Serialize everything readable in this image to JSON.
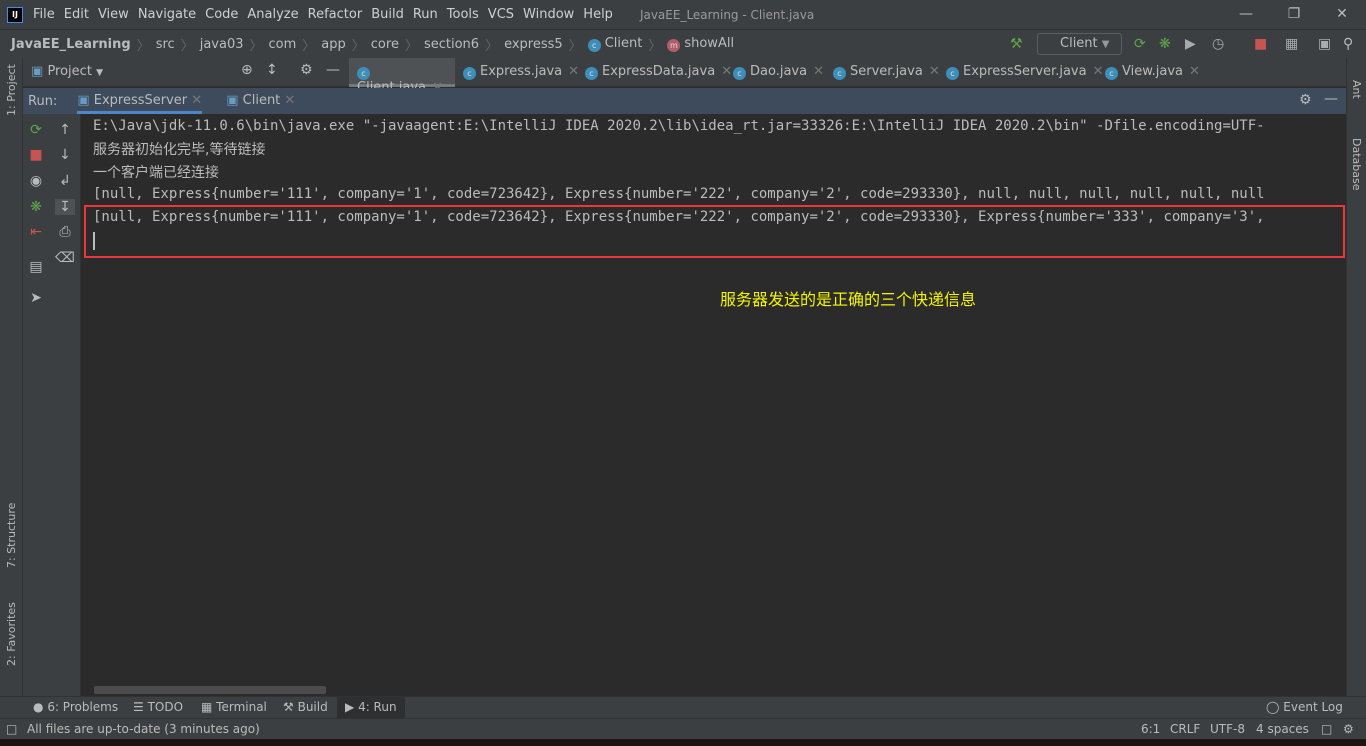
{
  "titlebar": {
    "menu": [
      "File",
      "Edit",
      "View",
      "Navigate",
      "Code",
      "Analyze",
      "Refactor",
      "Build",
      "Run",
      "Tools",
      "VCS",
      "Window",
      "Help"
    ],
    "title": "JavaEE_Learning - Client.java"
  },
  "navbar": {
    "crumbs": [
      "JavaEE_Learning",
      "src",
      "java03",
      "com",
      "app",
      "core",
      "section6",
      "express5"
    ],
    "class_crumb": "Client",
    "method_crumb": "showAll",
    "run_config": "Client"
  },
  "left_strip": {
    "project": "1: Project",
    "structure": "7: Structure",
    "favorites": "2: Favorites"
  },
  "right_strip": {
    "ant": "Ant",
    "database": "Database"
  },
  "project_tool": {
    "label": "Project"
  },
  "editor_tabs": [
    {
      "label": "Client.java",
      "active": true
    },
    {
      "label": "Express.java"
    },
    {
      "label": "ExpressData.java"
    },
    {
      "label": "Dao.java"
    },
    {
      "label": "Server.java"
    },
    {
      "label": "ExpressServer.java"
    },
    {
      "label": "View.java"
    }
  ],
  "run": {
    "label": "Run:",
    "tabs": [
      {
        "label": "ExpressServer",
        "active": true
      },
      {
        "label": "Client"
      }
    ]
  },
  "console": {
    "lines": [
      "E:\\Java\\jdk-11.0.6\\bin\\java.exe \"-javaagent:E:\\IntelliJ IDEA 2020.2\\lib\\idea_rt.jar=33326:E:\\IntelliJ IDEA 2020.2\\bin\" -Dfile.encoding=UTF-",
      "服务器初始化完毕,等待链接",
      "一个客户端已经连接",
      "[null, Express{number='111', company='1', code=723642}, Express{number='222', company='2', code=293330}, null, null, null, null, null, null",
      "[null, Express{number='111', company='1', code=723642}, Express{number='222', company='2', code=293330}, Express{number='333', company='3',"
    ]
  },
  "annotation": {
    "text": "服务器发送的是正确的三个快递信息",
    "color": "#f5f500",
    "box_color": "#e8383b"
  },
  "bottom_tools": {
    "problems": "6: Problems",
    "todo": "TODO",
    "terminal": "Terminal",
    "build": "Build",
    "run": "4: Run",
    "event_log": "Event Log"
  },
  "status": {
    "message": "All files are up-to-date (3 minutes ago)",
    "position": "6:1",
    "line_sep": "CRLF",
    "encoding": "UTF-8",
    "indent": "4 spaces"
  }
}
